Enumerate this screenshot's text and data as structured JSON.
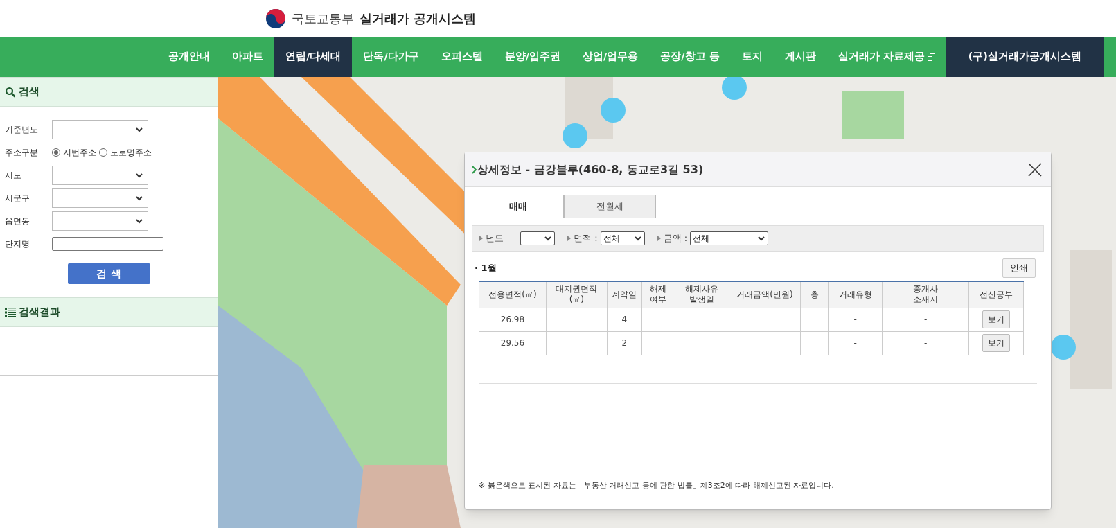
{
  "header": {
    "ministry": "국토교통부",
    "title": "실거래가 공개시스템"
  },
  "nav": [
    {
      "label": "공개안내",
      "kind": "normal",
      "selected": false
    },
    {
      "label": "아파트",
      "kind": "normal",
      "selected": false
    },
    {
      "label": "연립/다세대",
      "kind": "normal",
      "selected": true
    },
    {
      "label": "단독/다가구",
      "kind": "normal",
      "selected": false
    },
    {
      "label": "오피스텔",
      "kind": "normal",
      "selected": false
    },
    {
      "label": "분양/입주권",
      "kind": "normal",
      "selected": false
    },
    {
      "label": "상업/업무용",
      "kind": "normal",
      "selected": false
    },
    {
      "label": "공장/창고 등",
      "kind": "normal",
      "selected": false
    },
    {
      "label": "토지",
      "kind": "normal",
      "selected": false
    },
    {
      "label": "게시판",
      "kind": "normal",
      "selected": false
    },
    {
      "label": "실거래가 자료제공",
      "kind": "external",
      "selected": false
    }
  ],
  "legacy_link": "(구)실거래가공개시스템",
  "search": {
    "title": "검색",
    "fields": [
      {
        "label": "기준년도",
        "kind": "select"
      },
      {
        "label": "주소구분",
        "kind": "radio",
        "options": [
          {
            "label": "지번주소",
            "selected": true
          },
          {
            "label": "도로명주소",
            "selected": false
          }
        ]
      },
      {
        "label": "시도",
        "kind": "select"
      },
      {
        "label": "시군구",
        "kind": "select"
      },
      {
        "label": "읍면동",
        "kind": "select"
      },
      {
        "label": "단지명",
        "kind": "text"
      }
    ],
    "button": "검 색"
  },
  "results": {
    "title": "검색결과"
  },
  "dialog": {
    "title": "상세정보 - 금강블루(460-8, 동교로3길 53)",
    "tabs": [
      {
        "label": "매매",
        "selected": true
      },
      {
        "label": "전월세",
        "selected": false
      }
    ],
    "filters": [
      {
        "label": "년도"
      },
      {
        "label": "면적 :",
        "value": "전체"
      },
      {
        "label": "금액 :",
        "value": "전체"
      }
    ],
    "month": "· 1월",
    "print_button": "인쇄",
    "table": {
      "columns": [
        "전용면적(㎡)",
        "대지권면적\n(㎡)",
        "계약일",
        "해제\n여부",
        "해제사유\n발생일",
        "거래금액(만원)",
        "층",
        "거래유형",
        "중개사\n소재지",
        "전산공부"
      ],
      "rows": [
        {
          "cells": [
            "26.98",
            "",
            "4",
            "",
            "",
            "",
            "",
            "-",
            "-"
          ],
          "action": "보기"
        },
        {
          "cells": [
            "29.56",
            "",
            "2",
            "",
            "",
            "",
            "",
            "-",
            "-"
          ],
          "action": "보기"
        }
      ]
    },
    "note": "※ 붉은색으로 표시된 자료는「부동산 거래신고 등에 관한 법률」제3조2에 따라 해제신고된 자료입니다."
  }
}
